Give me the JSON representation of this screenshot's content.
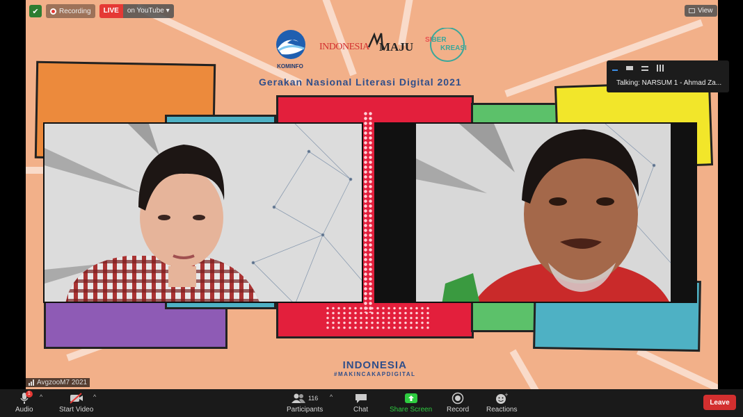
{
  "topbar": {
    "recording_label": "Recording",
    "live_label": "LIVE",
    "live_target": "on YouTube",
    "live_caret": "▾"
  },
  "view_button": {
    "label": "View"
  },
  "logos": {
    "kominfo": "KOMINFO",
    "indonesia_maju_a": "INDONESIA",
    "indonesia_maju_b": "MAJU",
    "siber_a": "SI",
    "siber_b": "BER",
    "siber_c": "KREASI"
  },
  "event_title": "Gerakan Nasional Literasi Digital 2021",
  "talking": {
    "text": "Talking: NARSUM 1 - Ahmad Za..."
  },
  "bottom_banner": {
    "title": "INDONESIA",
    "hashtag": "#MAKINCAKAPDIGITAL"
  },
  "name_tag": "AvgzooM7 2021",
  "toolbar": {
    "audio": "Audio",
    "audio_badge": "1",
    "start_video": "Start Video",
    "participants": "Participants",
    "participants_count": "116",
    "chat": "Chat",
    "share_screen": "Share Screen",
    "record": "Record",
    "reactions": "Reactions",
    "leave": "Leave"
  },
  "colors": {
    "background_peach": "#f2b089",
    "panel_orange": "#ec8a3c",
    "panel_red": "#e31f3c",
    "panel_green": "#5cc16a",
    "panel_yellow": "#f2e62a",
    "panel_purple": "#8e5bb5",
    "panel_teal": "#4eb1c4",
    "brand_blue": "#2f4e8a",
    "share_green": "#2ecc40",
    "leave_red": "#d32f2f"
  }
}
